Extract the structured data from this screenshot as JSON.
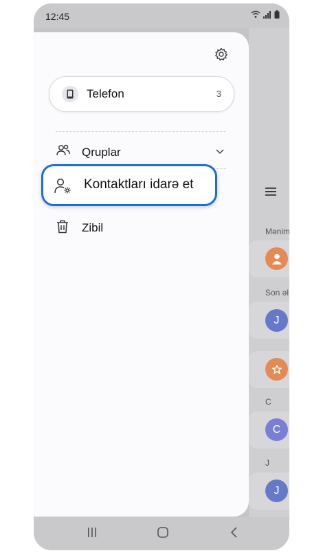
{
  "status": {
    "time": "12:45"
  },
  "drawer": {
    "account": {
      "label": "Telefon",
      "count": "3"
    },
    "items": [
      {
        "label": "Qruplar"
      },
      {
        "label": "Kontaktları idarə et"
      },
      {
        "label": "Zibil"
      }
    ]
  },
  "background": {
    "section_me": "Mənim",
    "section_recent": "Son əl",
    "section_c": "C",
    "section_j": "J",
    "avatars": [
      "J",
      "C",
      "J"
    ]
  },
  "colors": {
    "highlight": "#1a6fd6",
    "avatar_orange": "#e48a55",
    "avatar_blue": "#6679c8"
  }
}
